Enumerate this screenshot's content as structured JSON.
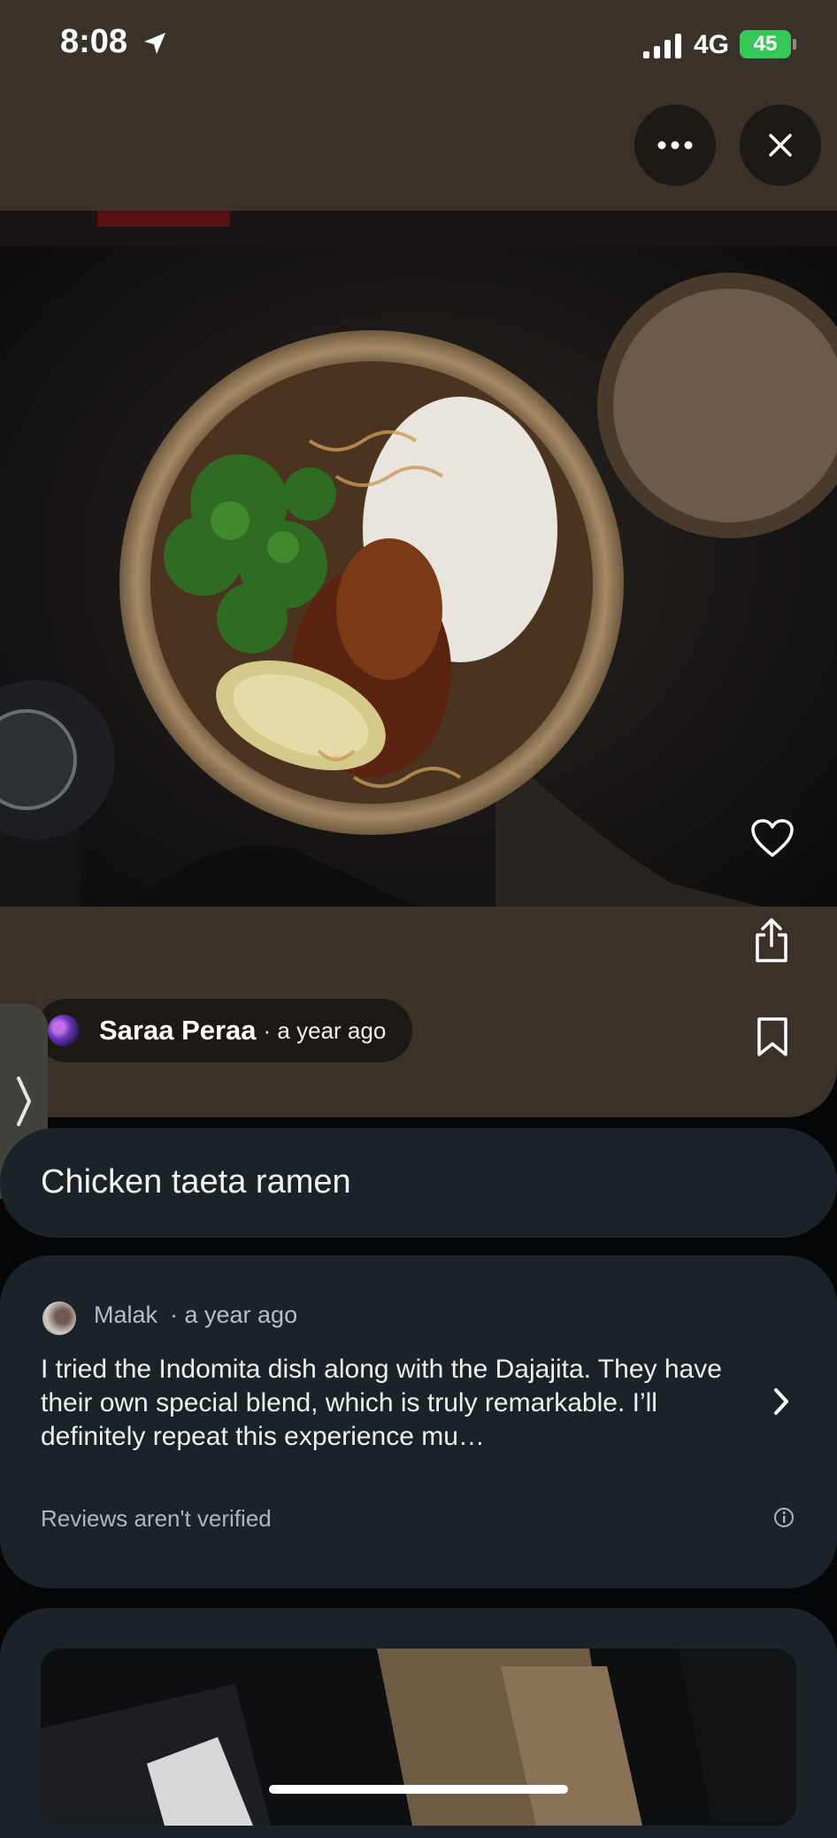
{
  "status_bar": {
    "time": "8:08",
    "network": "4G",
    "battery": "45"
  },
  "post": {
    "author": "Saraa Peraa",
    "time": "· a year ago",
    "title": "Chicken taeta ramen"
  },
  "review": {
    "author": "Malak",
    "time": "· a year ago",
    "text": "I tried the Indomita dish along with the Dajajita. They have their own special blend, which is truly remarkable. I’ll definitely repeat this experience mu…",
    "note": "Reviews aren't verified"
  },
  "icons": {
    "more": "more-icon",
    "close": "close-icon",
    "heart": "heart-icon",
    "share": "share-icon",
    "bookmark": "bookmark-icon",
    "chevron": "chevron-right-icon",
    "info": "info-icon",
    "location": "location-arrow-icon"
  },
  "colors": {
    "panel": "#3a3229",
    "card": "#1b2228",
    "battery": "#34c759"
  }
}
